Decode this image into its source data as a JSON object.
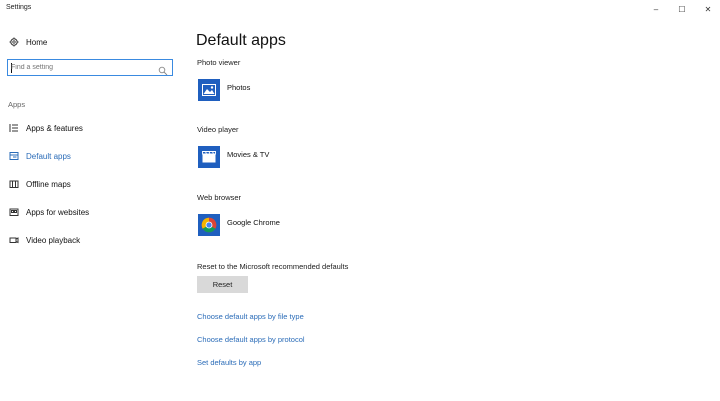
{
  "window": {
    "title": "Settings",
    "controls": {
      "minimize": "–",
      "maximize": "☐",
      "close": "✕"
    }
  },
  "sidebar": {
    "home_label": "Home",
    "search": {
      "placeholder": "Find a setting"
    },
    "section_header": "Apps",
    "items": [
      {
        "label": "Apps & features",
        "icon": "list-icon",
        "active": false
      },
      {
        "label": "Default apps",
        "icon": "default-apps-icon",
        "active": true
      },
      {
        "label": "Offline maps",
        "icon": "map-icon",
        "active": false
      },
      {
        "label": "Apps for websites",
        "icon": "website-icon",
        "active": false
      },
      {
        "label": "Video playback",
        "icon": "video-icon",
        "active": false
      }
    ]
  },
  "main": {
    "title": "Default apps",
    "categories": [
      {
        "label": "Photo viewer",
        "app": "Photos",
        "icon": "photos-icon"
      },
      {
        "label": "Video player",
        "app": "Movies & TV",
        "icon": "movies-tv-icon"
      },
      {
        "label": "Web browser",
        "app": "Google Chrome",
        "icon": "chrome-icon"
      }
    ],
    "reset": {
      "label": "Reset to the Microsoft recommended defaults",
      "button": "Reset"
    },
    "links": [
      "Choose default apps by file type",
      "Choose default apps by protocol",
      "Set defaults by app"
    ]
  },
  "colors": {
    "accent": "#2b6cb8",
    "tile_blue": "#1f5fbf",
    "search_border": "#3a8ae0",
    "button_bg": "#d9d9d9"
  }
}
